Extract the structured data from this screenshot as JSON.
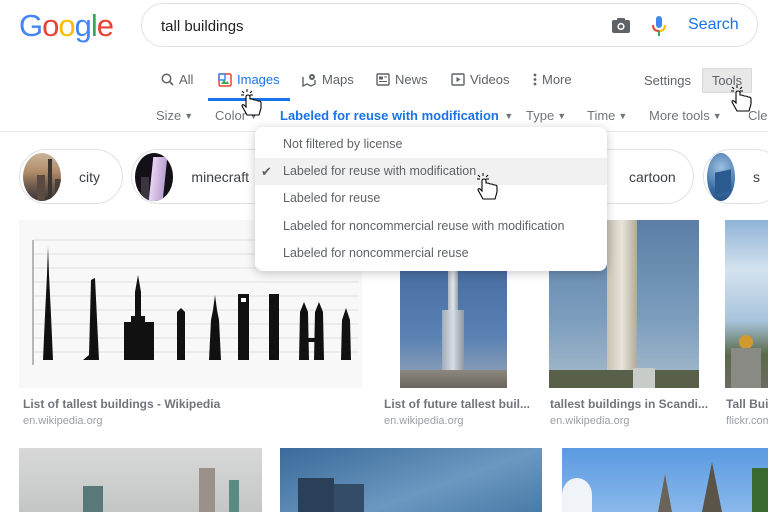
{
  "logo": {
    "letters": [
      "G",
      "o",
      "o",
      "g",
      "l",
      "e"
    ]
  },
  "search": {
    "query": "tall buildings",
    "button_label": "Search",
    "camera_icon": "camera-icon",
    "mic_icon": "microphone-icon"
  },
  "tabs": [
    {
      "label": "All",
      "icon": "search-icon",
      "active": false
    },
    {
      "label": "Images",
      "icon": "image-icon",
      "active": true
    },
    {
      "label": "Maps",
      "icon": "map-icon",
      "active": false
    },
    {
      "label": "News",
      "icon": "news-icon",
      "active": false
    },
    {
      "label": "Videos",
      "icon": "video-icon",
      "active": false
    },
    {
      "label": "More",
      "icon": "more-vert-icon",
      "active": false
    }
  ],
  "settings_label": "Settings",
  "tools_label": "Tools",
  "filters": [
    {
      "label": "Size",
      "active": false
    },
    {
      "label": "Color",
      "active": false
    },
    {
      "label": "Labeled for reuse with modification",
      "active": true
    },
    {
      "label": "Type",
      "active": false
    },
    {
      "label": "Time",
      "active": false
    },
    {
      "label": "More tools",
      "active": false
    },
    {
      "label": "Clea",
      "active": false
    }
  ],
  "dropdown": {
    "items": [
      {
        "label": "Not filtered by license",
        "selected": false
      },
      {
        "label": "Labeled for reuse with modification",
        "selected": true
      },
      {
        "label": "Labeled for reuse",
        "selected": false
      },
      {
        "label": "Labeled for noncommercial reuse with modification",
        "selected": false
      },
      {
        "label": "Labeled for noncommercial reuse",
        "selected": false
      }
    ],
    "check_glyph": "✔"
  },
  "chips": [
    {
      "label": "city"
    },
    {
      "label": "minecraft"
    },
    {
      "label": "cartoon"
    },
    {
      "label": "s"
    }
  ],
  "results": [
    {
      "title": "List of tallest buildings - Wikipedia",
      "source": "en.wikipedia.org"
    },
    {
      "title": "List of future tallest buil...",
      "source": "en.wikipedia.org"
    },
    {
      "title": "tallest buildings in Scandi...",
      "source": "en.wikipedia.org"
    },
    {
      "title": "Tall Buil",
      "source": "flickr.com"
    }
  ],
  "colors": {
    "accent": "#1a73e8",
    "text_muted": "#70757a"
  }
}
